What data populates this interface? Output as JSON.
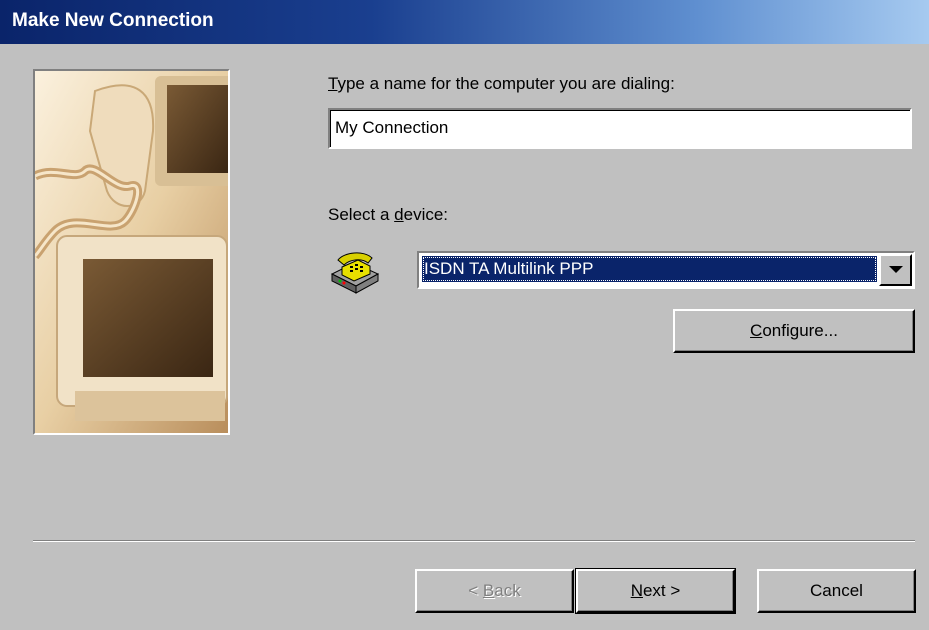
{
  "window": {
    "title": "Make New Connection"
  },
  "name_prompt": {
    "label_prefix_underlined": "T",
    "label_rest": "ype a name for the computer you are dialing:",
    "value": "My Connection"
  },
  "device": {
    "label_before": "Select a ",
    "label_underlined": "d",
    "label_after": "evice:",
    "icon": "telephone-modem-icon",
    "selected": "ISDN TA Multilink PPP",
    "configure_underlined": "C",
    "configure_rest": "onfigure..."
  },
  "footer": {
    "back_prefix": "< ",
    "back_underlined": "B",
    "back_rest": "ack",
    "next_underlined": "N",
    "next_rest": "ext >",
    "cancel": "Cancel"
  },
  "colors": {
    "face": "#c0c0c0",
    "title_start": "#0a246a",
    "title_end": "#a6caf0",
    "selection": "#0a246a"
  }
}
